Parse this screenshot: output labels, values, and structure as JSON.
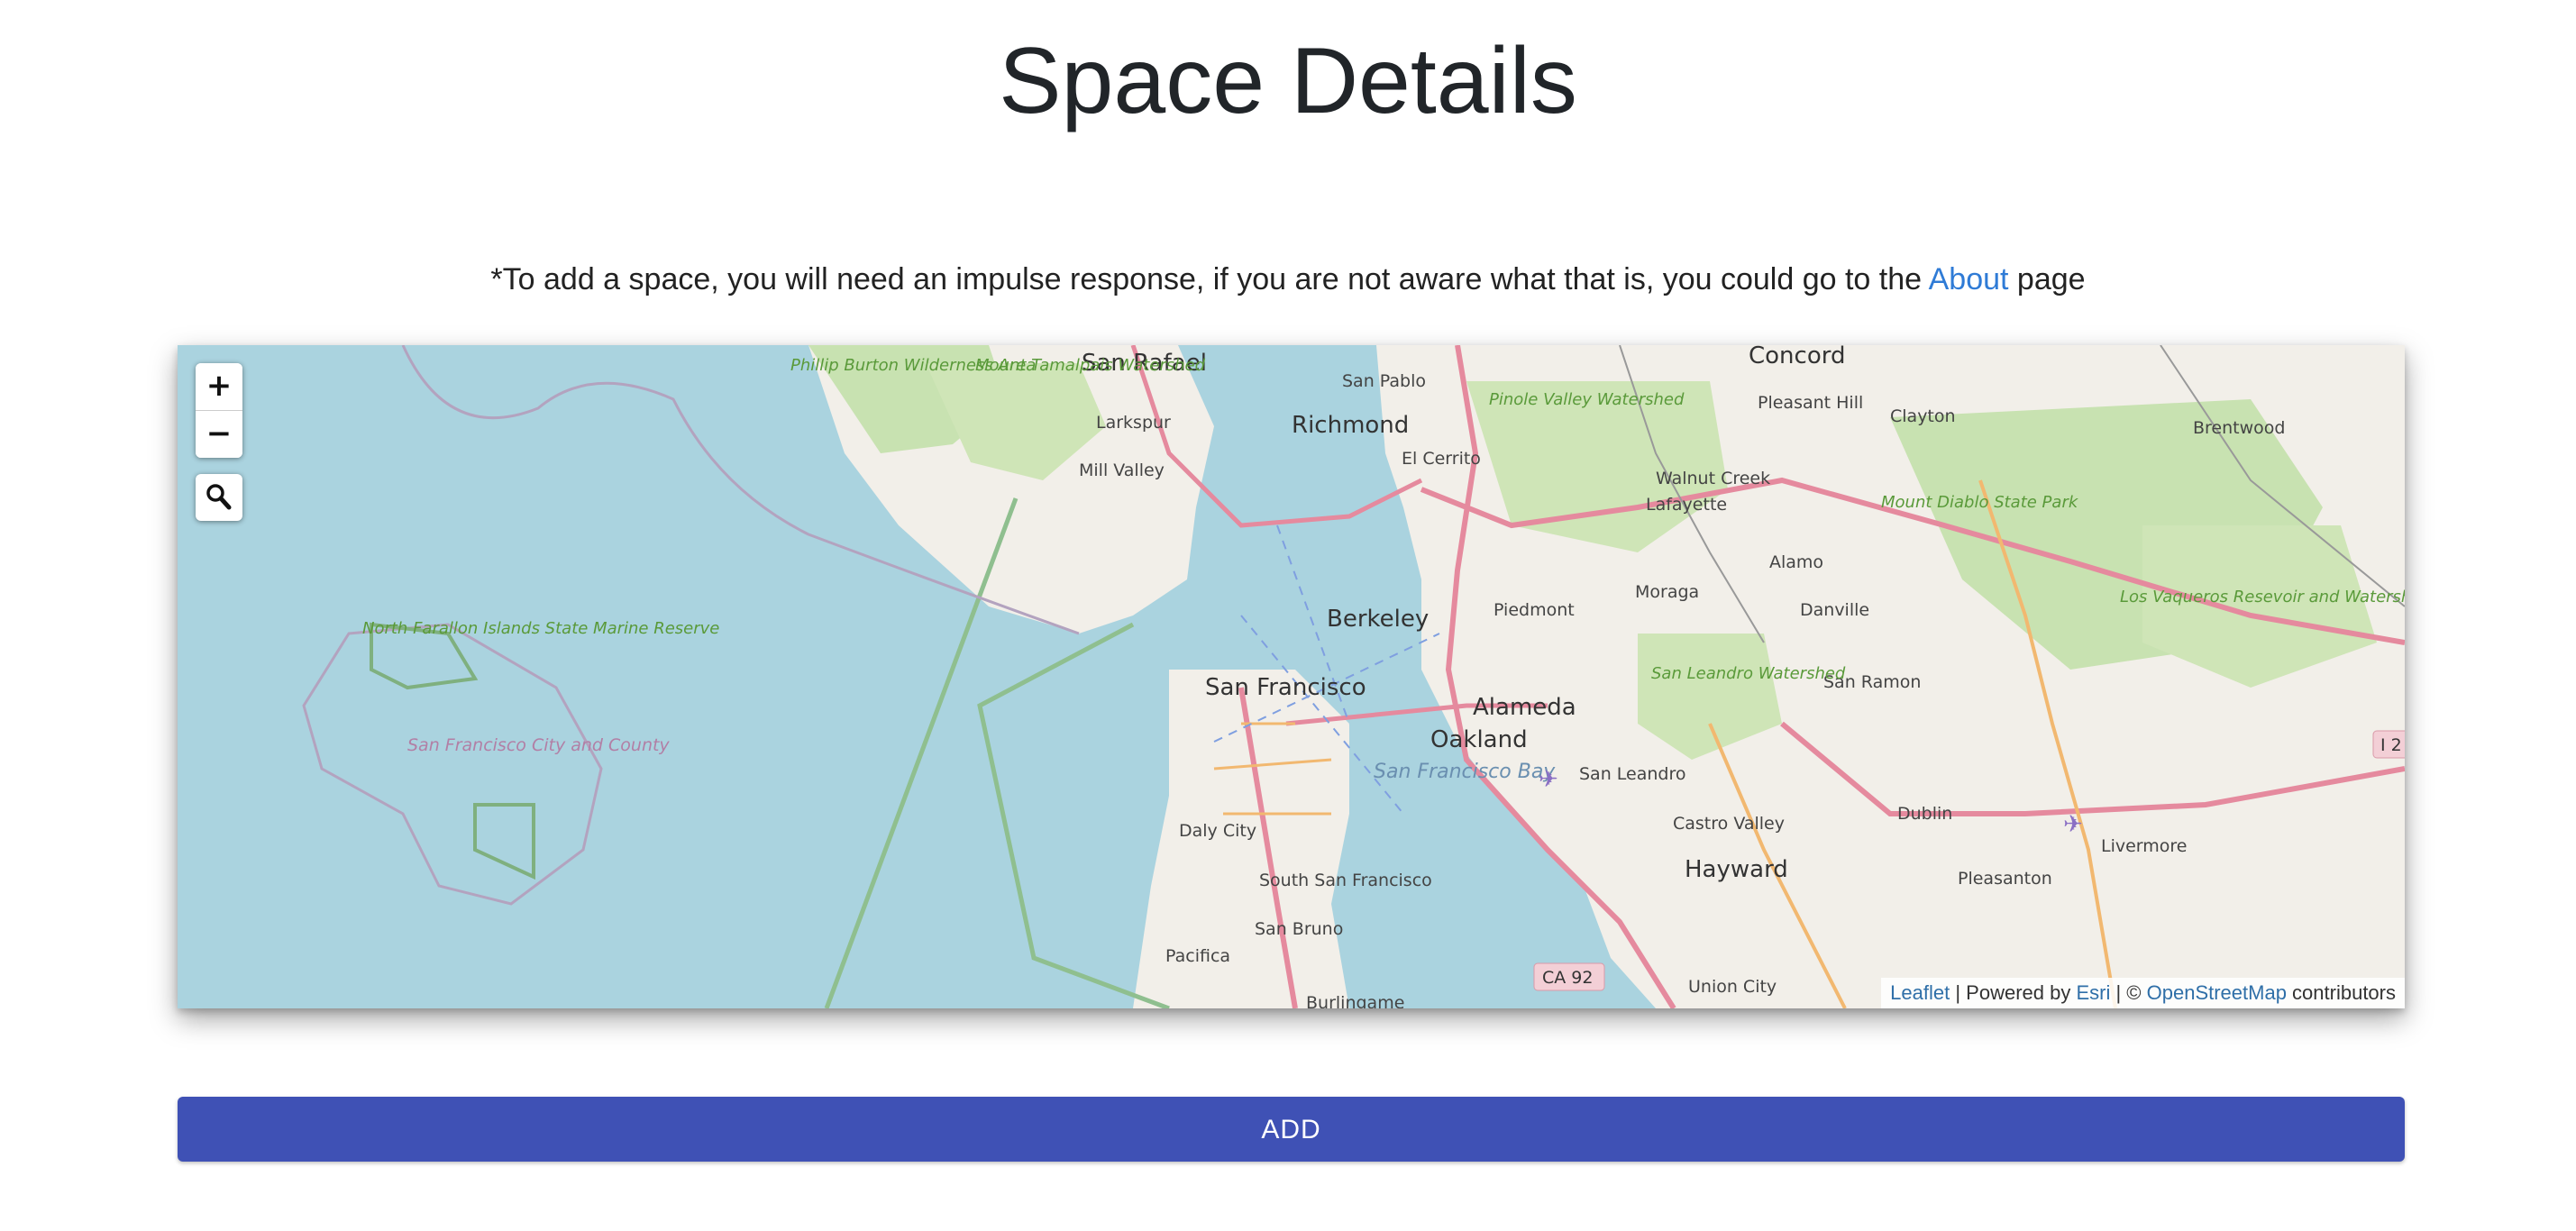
{
  "page": {
    "title": "Space Details"
  },
  "note": {
    "prefix": "*To add a space, you will need an impulse response, if you are not aware what that is, you could go to the ",
    "link": "About",
    "suffix": " page"
  },
  "map": {
    "zoom_in": "+",
    "zoom_out": "−",
    "search_icon": "search-icon",
    "colors": {
      "water": "#aad3df",
      "land": "#f2efe9",
      "park": "#c8e2b1",
      "road": "#e58a9e",
      "route": "#f2b870"
    },
    "labels": {
      "san_rafael": "San Rafael",
      "concord": "Concord",
      "san_pablo": "San Pablo",
      "richmond": "Richmond",
      "pinole": "Pinole Valley Watershed",
      "pleasant_hill": "Pleasant Hill",
      "clayton": "Clayton",
      "brentwood": "Brentwood",
      "larkspur": "Larkspur",
      "el_cerrito": "El Cerrito",
      "mill_valley": "Mill Valley",
      "walnut_creek": "Walnut Creek",
      "lafayette": "Lafayette",
      "mount_diablo": "Mount Diablo State Park",
      "berkeley": "Berkeley",
      "alamo": "Alamo",
      "moraga": "Moraga",
      "piedmont": "Piedmont",
      "danville": "Danville",
      "los_vaqueros": "Los Vaqueros Resevoir and Watershed",
      "oakland": "Oakland",
      "san_francisco": "San Francisco",
      "north_farallon": "North Farallon Islands State Marine Reserve",
      "sf_city_county": "San Francisco City and County",
      "alameda": "Alameda",
      "san_leandro_watershed": "San Leandro Watershed",
      "san_ramon": "San Ramon",
      "sf_bay": "San Francisco Bay",
      "san_leandro": "San Leandro",
      "castro_valley": "Castro Valley",
      "dublin": "Dublin",
      "livermore": "Livermore",
      "daly_city": "Daly City",
      "hayward": "Hayward",
      "pleasanton": "Pleasanton",
      "south_sf": "South San Francisco",
      "san_bruno": "San Bruno",
      "pacifica": "Pacifica",
      "burlingame": "Burlingame",
      "union_city": "Union City",
      "mount_tamalpais": "Mount Tamalpais Watershed",
      "burton": "Phillip Burton Wilderness Area",
      "ca92": "CA 92",
      "i_shield": "I 2"
    },
    "attribution": {
      "leaflet": "Leaflet",
      "powered_by": " | Powered by ",
      "esri": "Esri",
      "sep": " | © ",
      "osm": "OpenStreetMap",
      "contributors": " contributors"
    }
  },
  "actions": {
    "add_label": "ADD"
  }
}
